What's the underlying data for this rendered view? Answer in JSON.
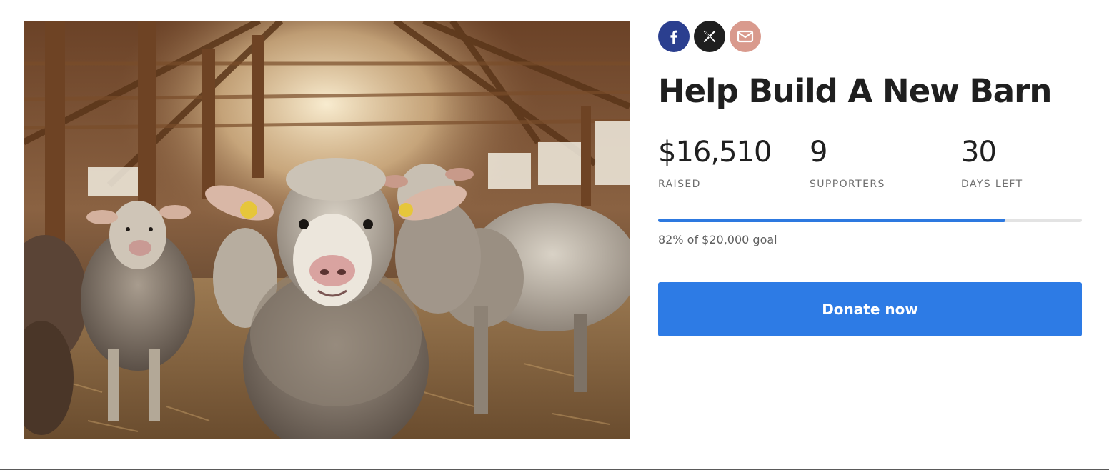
{
  "campaign": {
    "title": "Help Build A New Barn",
    "image_alt": "Sheep in a barn",
    "stats": [
      {
        "value": "$16,510",
        "label": "RAISED"
      },
      {
        "value": "9",
        "label": "SUPPORTERS"
      },
      {
        "value": "30",
        "label": "DAYS LEFT"
      }
    ],
    "progress": {
      "percent": 82,
      "text": "82% of $20,000 goal"
    },
    "donate_label": "Donate now"
  },
  "share": [
    {
      "icon": "facebook-icon",
      "color": "#2b3f8f"
    },
    {
      "icon": "x-icon",
      "color": "#1f1f1f"
    },
    {
      "icon": "email-icon",
      "color": "#d99a8d"
    }
  ],
  "colors": {
    "accent": "#2d7be5",
    "progress_track": "#e3e3e3"
  }
}
